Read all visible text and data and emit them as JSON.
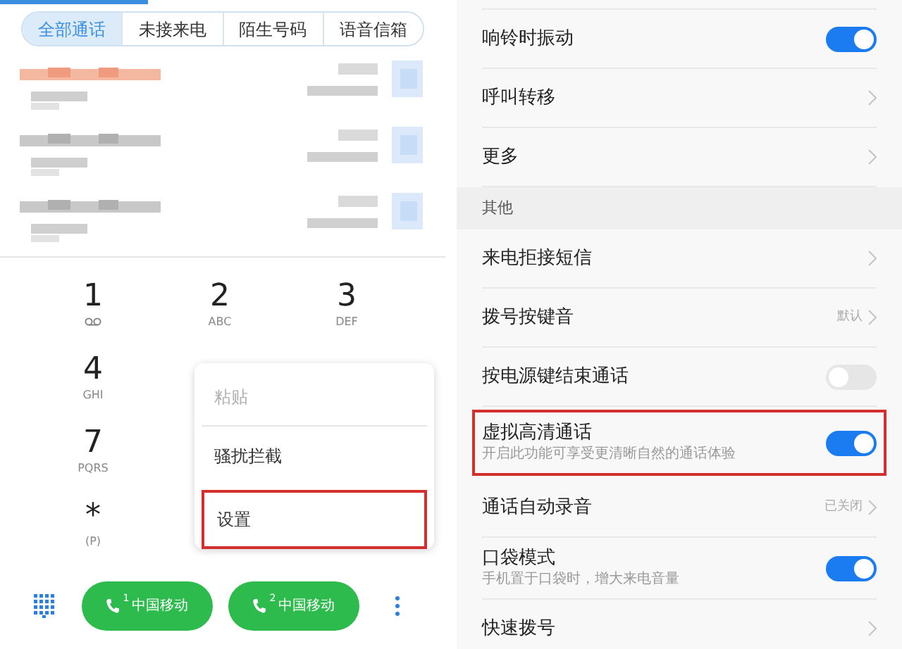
{
  "dialer": {
    "tabs": [
      {
        "label": "全部通话",
        "selected": true
      },
      {
        "label": "未接来电",
        "selected": false
      },
      {
        "label": "陌生号码",
        "selected": false
      },
      {
        "label": "语音信箱",
        "selected": false
      }
    ],
    "call_log": [
      {
        "missed": true
      },
      {
        "missed": false
      },
      {
        "missed": false
      }
    ],
    "dialpad": [
      {
        "digit": "1",
        "kind": "voicemail"
      },
      {
        "digit": "2",
        "letters": "ABC",
        "kind": "letters"
      },
      {
        "digit": "3",
        "letters": "DEF",
        "kind": "letters"
      },
      {
        "digit": "4",
        "letters": "GHI",
        "kind": "letters"
      },
      {
        "kind": "empty"
      },
      {
        "kind": "empty"
      },
      {
        "digit": "7",
        "letters": "PQRS",
        "kind": "letters"
      },
      {
        "kind": "empty"
      },
      {
        "kind": "empty"
      },
      {
        "digit": "*",
        "letters": "(P)",
        "kind": "letters"
      }
    ],
    "menu": [
      {
        "label": "粘贴",
        "disabled": true,
        "highlighted": false
      },
      {
        "label": "骚扰拦截",
        "disabled": false,
        "highlighted": false
      },
      {
        "label": "设置",
        "disabled": false,
        "highlighted": true
      }
    ],
    "call_buttons": [
      {
        "sim": "1",
        "label": "中国移动"
      },
      {
        "sim": "2",
        "label": "中国移动"
      }
    ]
  },
  "settings": [
    {
      "kind": "toggle",
      "label": "响铃时振动",
      "on": true,
      "highlighted": false
    },
    {
      "kind": "link",
      "label": "呼叫转移",
      "highlighted": false
    },
    {
      "kind": "link",
      "label": "更多",
      "highlighted": false
    },
    {
      "kind": "header",
      "label": "其他"
    },
    {
      "kind": "link",
      "label": "来电拒接短信",
      "highlighted": false
    },
    {
      "kind": "link",
      "label": "拨号按键音",
      "value": "默认",
      "highlighted": false
    },
    {
      "kind": "toggle",
      "label": "按电源键结束通话",
      "on": false,
      "highlighted": false
    },
    {
      "kind": "toggle",
      "label": "虚拟高清通话",
      "subtitle": "开启此功能可享受更清晰自然的通话体验",
      "on": true,
      "highlighted": true
    },
    {
      "kind": "link",
      "label": "通话自动录音",
      "value": "已关闭",
      "highlighted": false
    },
    {
      "kind": "toggle",
      "label": "口袋模式",
      "subtitle": "手机置于口袋时，增大来电音量",
      "on": true,
      "highlighted": false
    },
    {
      "kind": "link",
      "label": "快速拨号",
      "highlighted": false
    }
  ]
}
